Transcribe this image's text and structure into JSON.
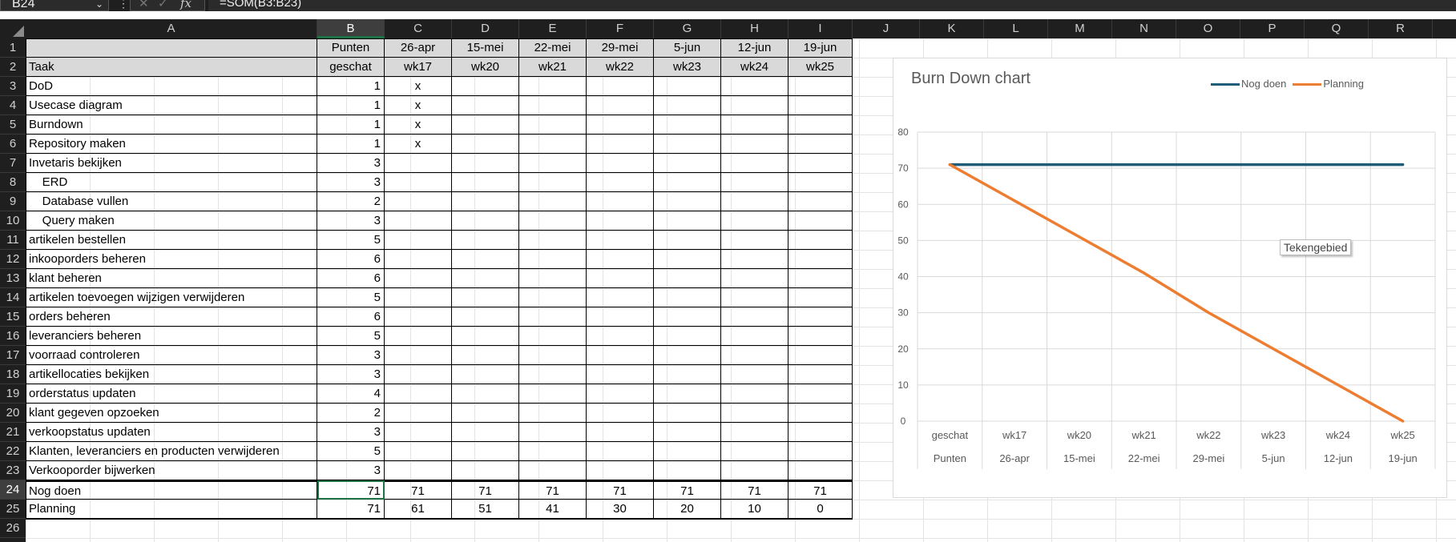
{
  "formula_bar": {
    "name_box": "B24",
    "formula": "=SOM(B3:B23)"
  },
  "columns": [
    "A",
    "B",
    "C",
    "D",
    "E",
    "F",
    "G",
    "H",
    "I",
    "J",
    "K",
    "L",
    "M",
    "N",
    "O",
    "P",
    "Q",
    "R"
  ],
  "selected_column": "B",
  "rows": [
    "1",
    "2",
    "3",
    "4",
    "5",
    "6",
    "7",
    "8",
    "9",
    "10",
    "11",
    "12",
    "13",
    "14",
    "15",
    "16",
    "17",
    "18",
    "19",
    "20",
    "21",
    "22",
    "23",
    "24",
    "25",
    "26"
  ],
  "selected_row": "24",
  "header_row1": [
    "",
    "Punten",
    "26-apr",
    "15-mei",
    "22-mei",
    "29-mei",
    "5-jun",
    "12-jun",
    "19-jun"
  ],
  "header_row2": [
    "Taak",
    "geschat",
    "wk17",
    "wk20",
    "wk21",
    "wk22",
    "wk23",
    "wk24",
    "wk25"
  ],
  "tasks": [
    {
      "name": "DoD",
      "points": "1",
      "c": "x"
    },
    {
      "name": "Usecase diagram",
      "points": "1",
      "c": "x"
    },
    {
      "name": "Burndown",
      "points": "1",
      "c": "x"
    },
    {
      "name": "Repository maken",
      "points": "1",
      "c": "x"
    },
    {
      "name": "Invetaris bekijken",
      "points": "3",
      "c": ""
    },
    {
      "name": "  ERD",
      "points": "3",
      "c": ""
    },
    {
      "name": "  Database vullen",
      "points": "2",
      "c": ""
    },
    {
      "name": "  Query maken",
      "points": "3",
      "c": ""
    },
    {
      "name": "artikelen bestellen",
      "points": "5",
      "c": ""
    },
    {
      "name": "inkooporders beheren",
      "points": "6",
      "c": ""
    },
    {
      "name": "klant beheren",
      "points": "6",
      "c": ""
    },
    {
      "name": "artikelen toevoegen wijzigen verwijderen",
      "points": "5",
      "c": ""
    },
    {
      "name": "orders beheren",
      "points": "6",
      "c": ""
    },
    {
      "name": "leveranciers beheren",
      "points": "5",
      "c": ""
    },
    {
      "name": "voorraad controleren",
      "points": "3",
      "c": ""
    },
    {
      "name": "artikellocaties bekijken",
      "points": "3",
      "c": ""
    },
    {
      "name": "orderstatus updaten",
      "points": "4",
      "c": ""
    },
    {
      "name": "klant gegeven opzoeken",
      "points": "2",
      "c": ""
    },
    {
      "name": "verkoopstatus updaten",
      "points": "3",
      "c": ""
    },
    {
      "name": "Klanten, leveranciers en producten verwijderen",
      "points": "5",
      "c": ""
    },
    {
      "name": "Verkooporder bijwerken",
      "points": "3",
      "c": ""
    }
  ],
  "nog_doen_row": [
    "Nog doen",
    "71",
    "71",
    "71",
    "71",
    "71",
    "71",
    "71",
    "71"
  ],
  "planning_row": [
    "Planning",
    "71",
    "61",
    "51",
    "41",
    "30",
    "20",
    "10",
    "0"
  ],
  "chart_data": {
    "type": "line",
    "title": "Burn Down chart",
    "categories_top": [
      "geschat",
      "wk17",
      "wk20",
      "wk21",
      "wk22",
      "wk23",
      "wk24",
      "wk25"
    ],
    "categories_bottom": [
      "Punten",
      "26-apr",
      "15-mei",
      "22-mei",
      "29-mei",
      "5-jun",
      "12-jun",
      "19-jun"
    ],
    "y_ticks": [
      "0",
      "10",
      "20",
      "30",
      "40",
      "50",
      "60",
      "70",
      "80"
    ],
    "ylim": [
      0,
      80
    ],
    "grid": true,
    "legend_position": "top-right",
    "series": [
      {
        "name": "Nog doen",
        "color": "#1f5c7a",
        "values": [
          71,
          71,
          71,
          71,
          71,
          71,
          71,
          71
        ]
      },
      {
        "name": "Planning",
        "color": "#ed7d31",
        "values": [
          71,
          61,
          51,
          41,
          30,
          20,
          10,
          0
        ]
      }
    ]
  },
  "chart_tooltip": "Tekengebied",
  "colors": {
    "header_bg": "#d9d9d9",
    "selection": "#1e7145",
    "dark_chrome": "#1f1f1f"
  }
}
